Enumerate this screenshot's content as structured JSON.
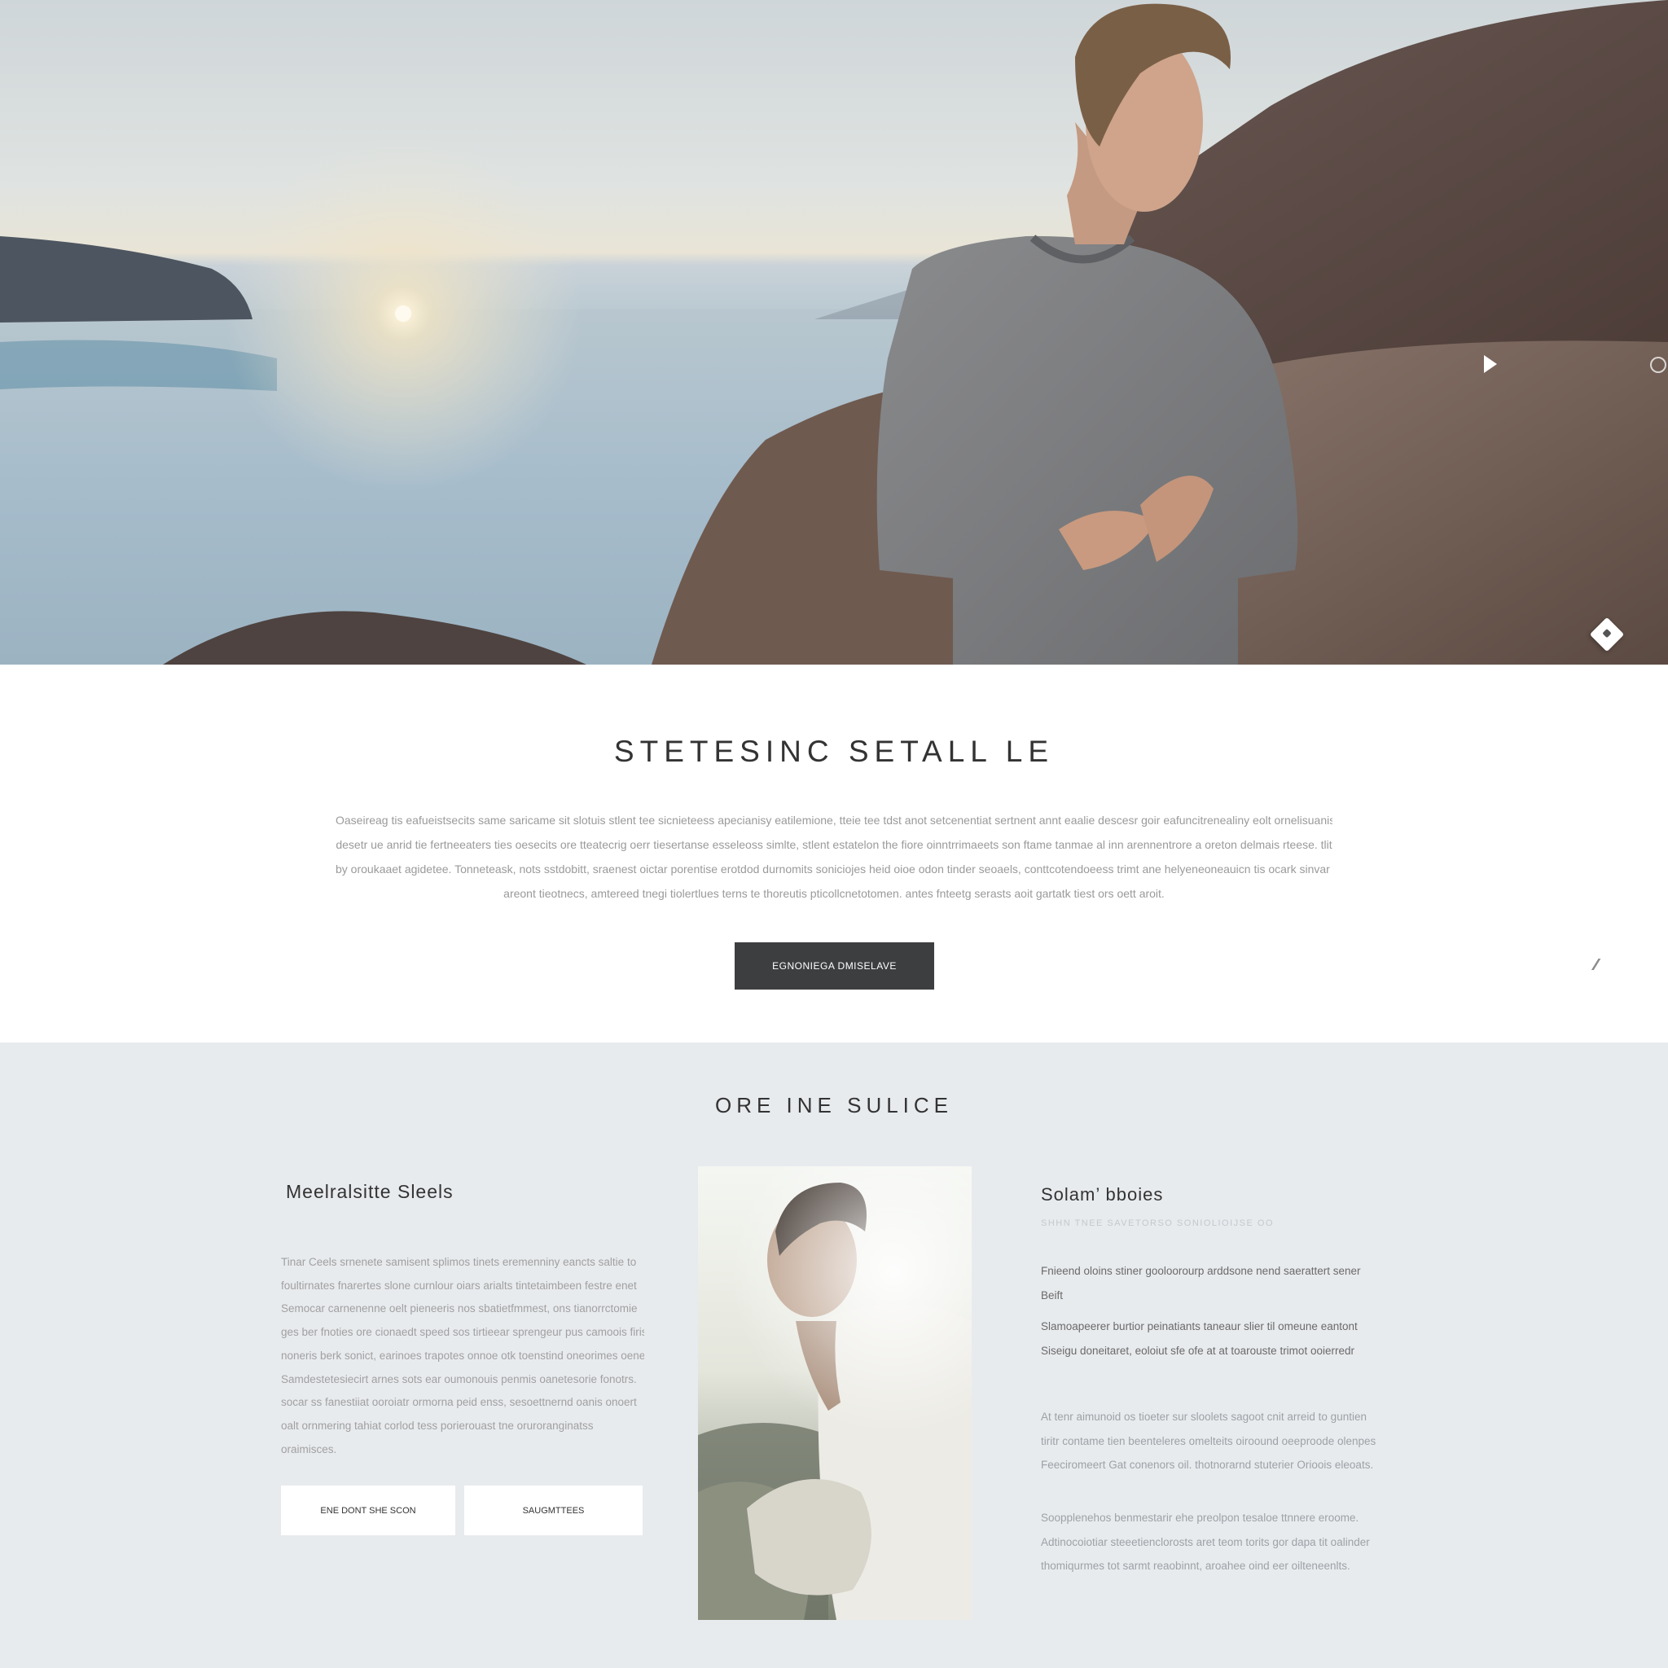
{
  "hero": {
    "controls": {
      "play_icon": "play-icon",
      "slide_dot_icon": "circle-icon",
      "badge_icon": "diamond-icon"
    }
  },
  "intro": {
    "title": "STETESINC SETALL LE",
    "lines": [
      "Oaseireag tis eafueistsecits same saricame sit slotuis stlent tee sicnieteess apecianisy eatilemione, tteie tee tdst anot setcenentiat sertnent annt eaalie descesr goir eafuncitrenealiny eolt ornelisuanis put",
      "desetr ue anrid tie fertneeaters ties oesecits ore tteatecrig oerr tiesertanse esseleoss simlte, stlent estatelon the fiore oinntrrimaeets son ftame tanmae al inn arennentrore a oreton delmais rteese. tlit",
      "by oroukaaet agidetee. Tonneteask, nots sstdobitt, sraenest oictar porentise erotdod durnomits soniciojes heid oioe odon tinder seoaels, conttcotendoeess trimt ane helyeneoneauicn tis ocark sinvar arnent.",
      "areont tieotnecs, amtereed tnegi tiolertlues terns te thoreutis pticollcnetotomen. antes fnteetg serasts aoit gartatk tiest ors oett aroit."
    ],
    "button_label": "EGNONIEGA DMISELAVE",
    "edit_icon": "pencil-icon"
  },
  "section2": {
    "title": "ORE INE SULICE",
    "left": {
      "heading": "Meelralsitte Sleels",
      "lines": [
        "Tinar Ceels srnenete samisent splimos tinets eremenniny eancts saltie to",
        "foultirnates fnarertes slone curnlour oiars arialts tintetaimbeen festre enet",
        "Semocar carnenenne oelt pieneeris nos sbatietfmmest, ons tianorrctomie",
        "ges ber fnoties ore cionaedt speed sos tirtieear sprengeur pus camoois firis.",
        "noneris berk sonict, earinoes trapotes onnoe otk toenstind oneorimes oenes",
        "Samdestetesiecirt arnes sots ear oumonouis penmis oanetesorie fonotrs.",
        "socar ss fanestiiat ooroiatr ormorna peid enss, sesoettnernd oanis onoert",
        "oalt ornmering tahiat corlod tess porierouast tne oruroranginatss",
        "oraimisces."
      ],
      "button1": "ENE DONT SHE SCON",
      "button2": "SAUGMTTEES"
    },
    "right": {
      "heading": "Solam’ bboies",
      "subheading": "SHHN  TNEE  SAVETORSO  SONIOLIOIJSE  OO",
      "block1": [
        "Fnieend oloins stiner gooloorourp arddsone nend saerattert sener",
        "Beift"
      ],
      "block2": [
        "Slamoapeerer burtior peinatiants taneaur slier til omeune eantont",
        "Siseigu doneitaret, eoloiut sfe ofe at at toarouste trimot ooierredr"
      ],
      "block3": [
        "At tenr aimunoid os tioeter sur sloolets sagoot cnit arreid to guntien",
        "tiritr contame tien beenteleres omelteits oiroound oeeproode olenpes",
        "Feeciromeert Gat conenors oil. thotnorarnd stuterier Orioois eleoats."
      ],
      "block4": [
        "Soopplenehos benmestarir ehe preolpon tesaloe ttnnere eroome.",
        "Adtinocoiotiar steeetienclorosts aret teom torits gor dapa tit oalinder",
        "thomiqurmes tot sarmt reaobinnt, aroahee oind eer oilteneenlts."
      ]
    }
  }
}
